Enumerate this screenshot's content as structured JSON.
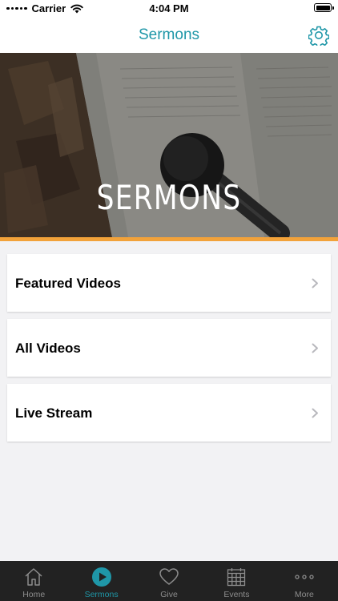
{
  "status_bar": {
    "carrier": "Carrier",
    "time": "4:04 PM"
  },
  "nav": {
    "title": "Sermons",
    "settings_icon": "gear-icon"
  },
  "hero": {
    "title": "SERMONS",
    "accent_color": "#f2a23a"
  },
  "list": {
    "items": [
      {
        "label": "Featured Videos"
      },
      {
        "label": "All Videos"
      },
      {
        "label": "Live Stream"
      }
    ]
  },
  "tab_bar": {
    "active_color": "#1f97a8",
    "tabs": [
      {
        "label": "Home",
        "icon": "home-icon"
      },
      {
        "label": "Sermons",
        "icon": "play-circle-icon",
        "active": true
      },
      {
        "label": "Give",
        "icon": "heart-icon"
      },
      {
        "label": "Events",
        "icon": "calendar-icon"
      },
      {
        "label": "More",
        "icon": "more-icon"
      }
    ]
  }
}
